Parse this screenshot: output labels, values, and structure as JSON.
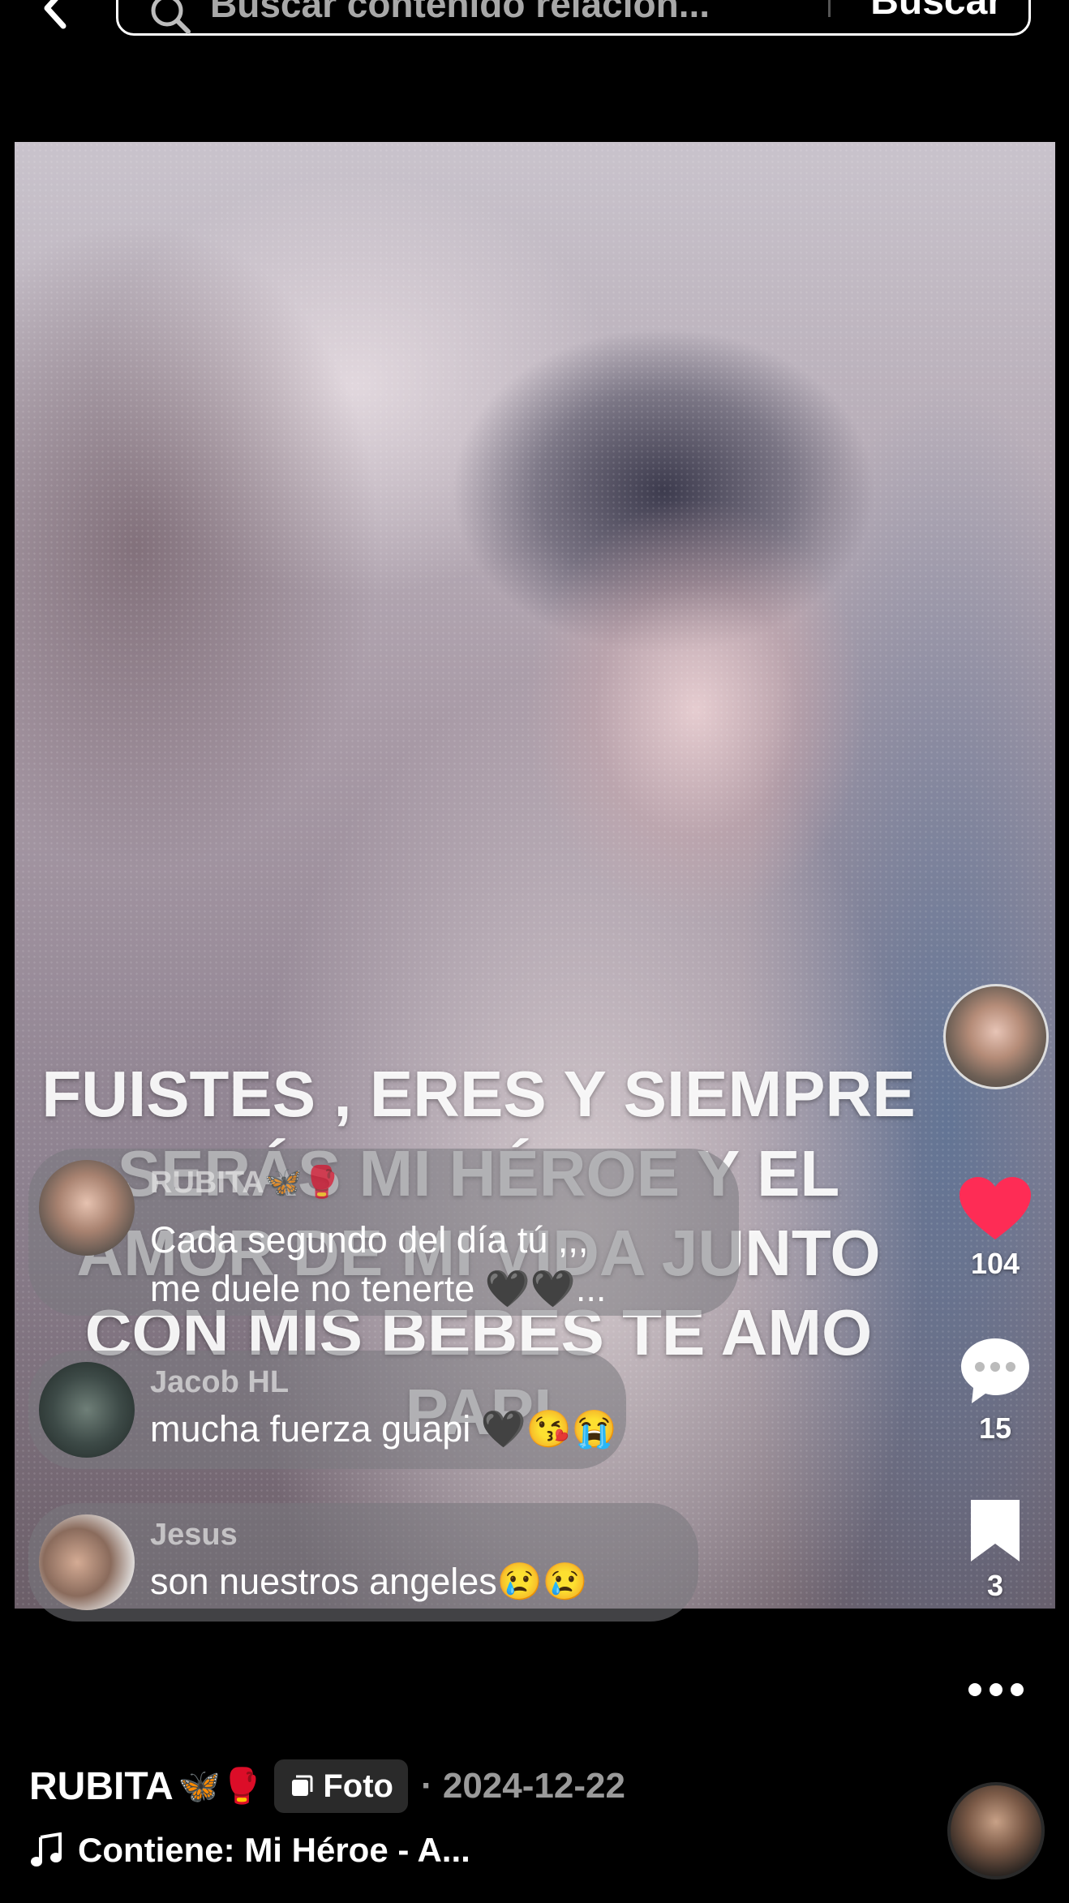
{
  "search": {
    "placeholder": "Buscar contenido relacion...",
    "button_label": "Buscar"
  },
  "post": {
    "overlay_text": "FUISTES , ERES Y SIEMPRE SERÁS MI HÉROE Y EL AMOR DE MI VIDA JUNTO CON MIS BEBES TE AMO PAPI",
    "author": "RUBITA",
    "author_emoji": "🦋🥊",
    "type_badge": "Foto",
    "date_separator": "·",
    "date": "2024-12-22",
    "music": "Contiene: Mi Héroe - A..."
  },
  "actions": {
    "likes": "104",
    "comments": "15",
    "saves": "3",
    "like_color": "#fe2c55"
  },
  "floating_comments": [
    {
      "name": "RUBITA🦋🥊",
      "text_line1": "Cada segundo del día tú ,,,",
      "text_line2": "me duele no tenerte 🖤🖤..."
    },
    {
      "name": "Jacob HL",
      "text_line1": "mucha fuerza guapi 🖤😘😭"
    },
    {
      "name": "Jesus",
      "text_line1": "son nuestros angeles😢😢"
    }
  ],
  "icons": [
    "back-icon",
    "search-icon",
    "heart-icon",
    "comment-icon",
    "bookmark-icon",
    "more-icon",
    "photo-icon",
    "music-note-icon"
  ]
}
